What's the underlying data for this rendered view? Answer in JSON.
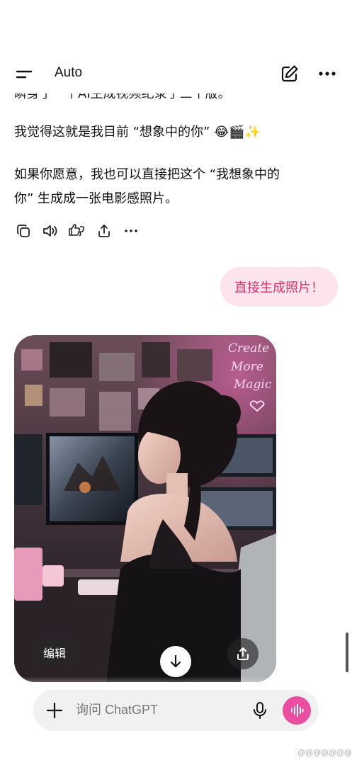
{
  "header": {
    "model": "Auto",
    "menu_icon": "menu-icon",
    "new_chat_icon": "edit-icon",
    "more_icon": "more-horizontal-icon"
  },
  "assistant": {
    "cut_line": "瞬身了一个AI生成视频纪录了三个版。",
    "p1_text": "我觉得这就是我目前 “想象中的你” ",
    "p1_emojis": "😂🎬✨",
    "p2_line1": "如果你愿意，我也可以直接把这个 “我想象中的",
    "p2_line2": "你” 生成成一张电影感照片。",
    "actions": [
      "copy-icon",
      "read-aloud-icon",
      "feedback-icon",
      "share-icon",
      "more-icon"
    ]
  },
  "user": {
    "message": "直接生成照片！"
  },
  "image": {
    "neon_line1": "Create",
    "neon_line2": "More",
    "neon_line3": "Magic",
    "edit_label": "编辑",
    "accent": "#ff6fc0"
  },
  "composer": {
    "placeholder": "询问 ChatGPT",
    "accent": "#e94ea0"
  },
  "watermark": "@@@@@@@@@"
}
